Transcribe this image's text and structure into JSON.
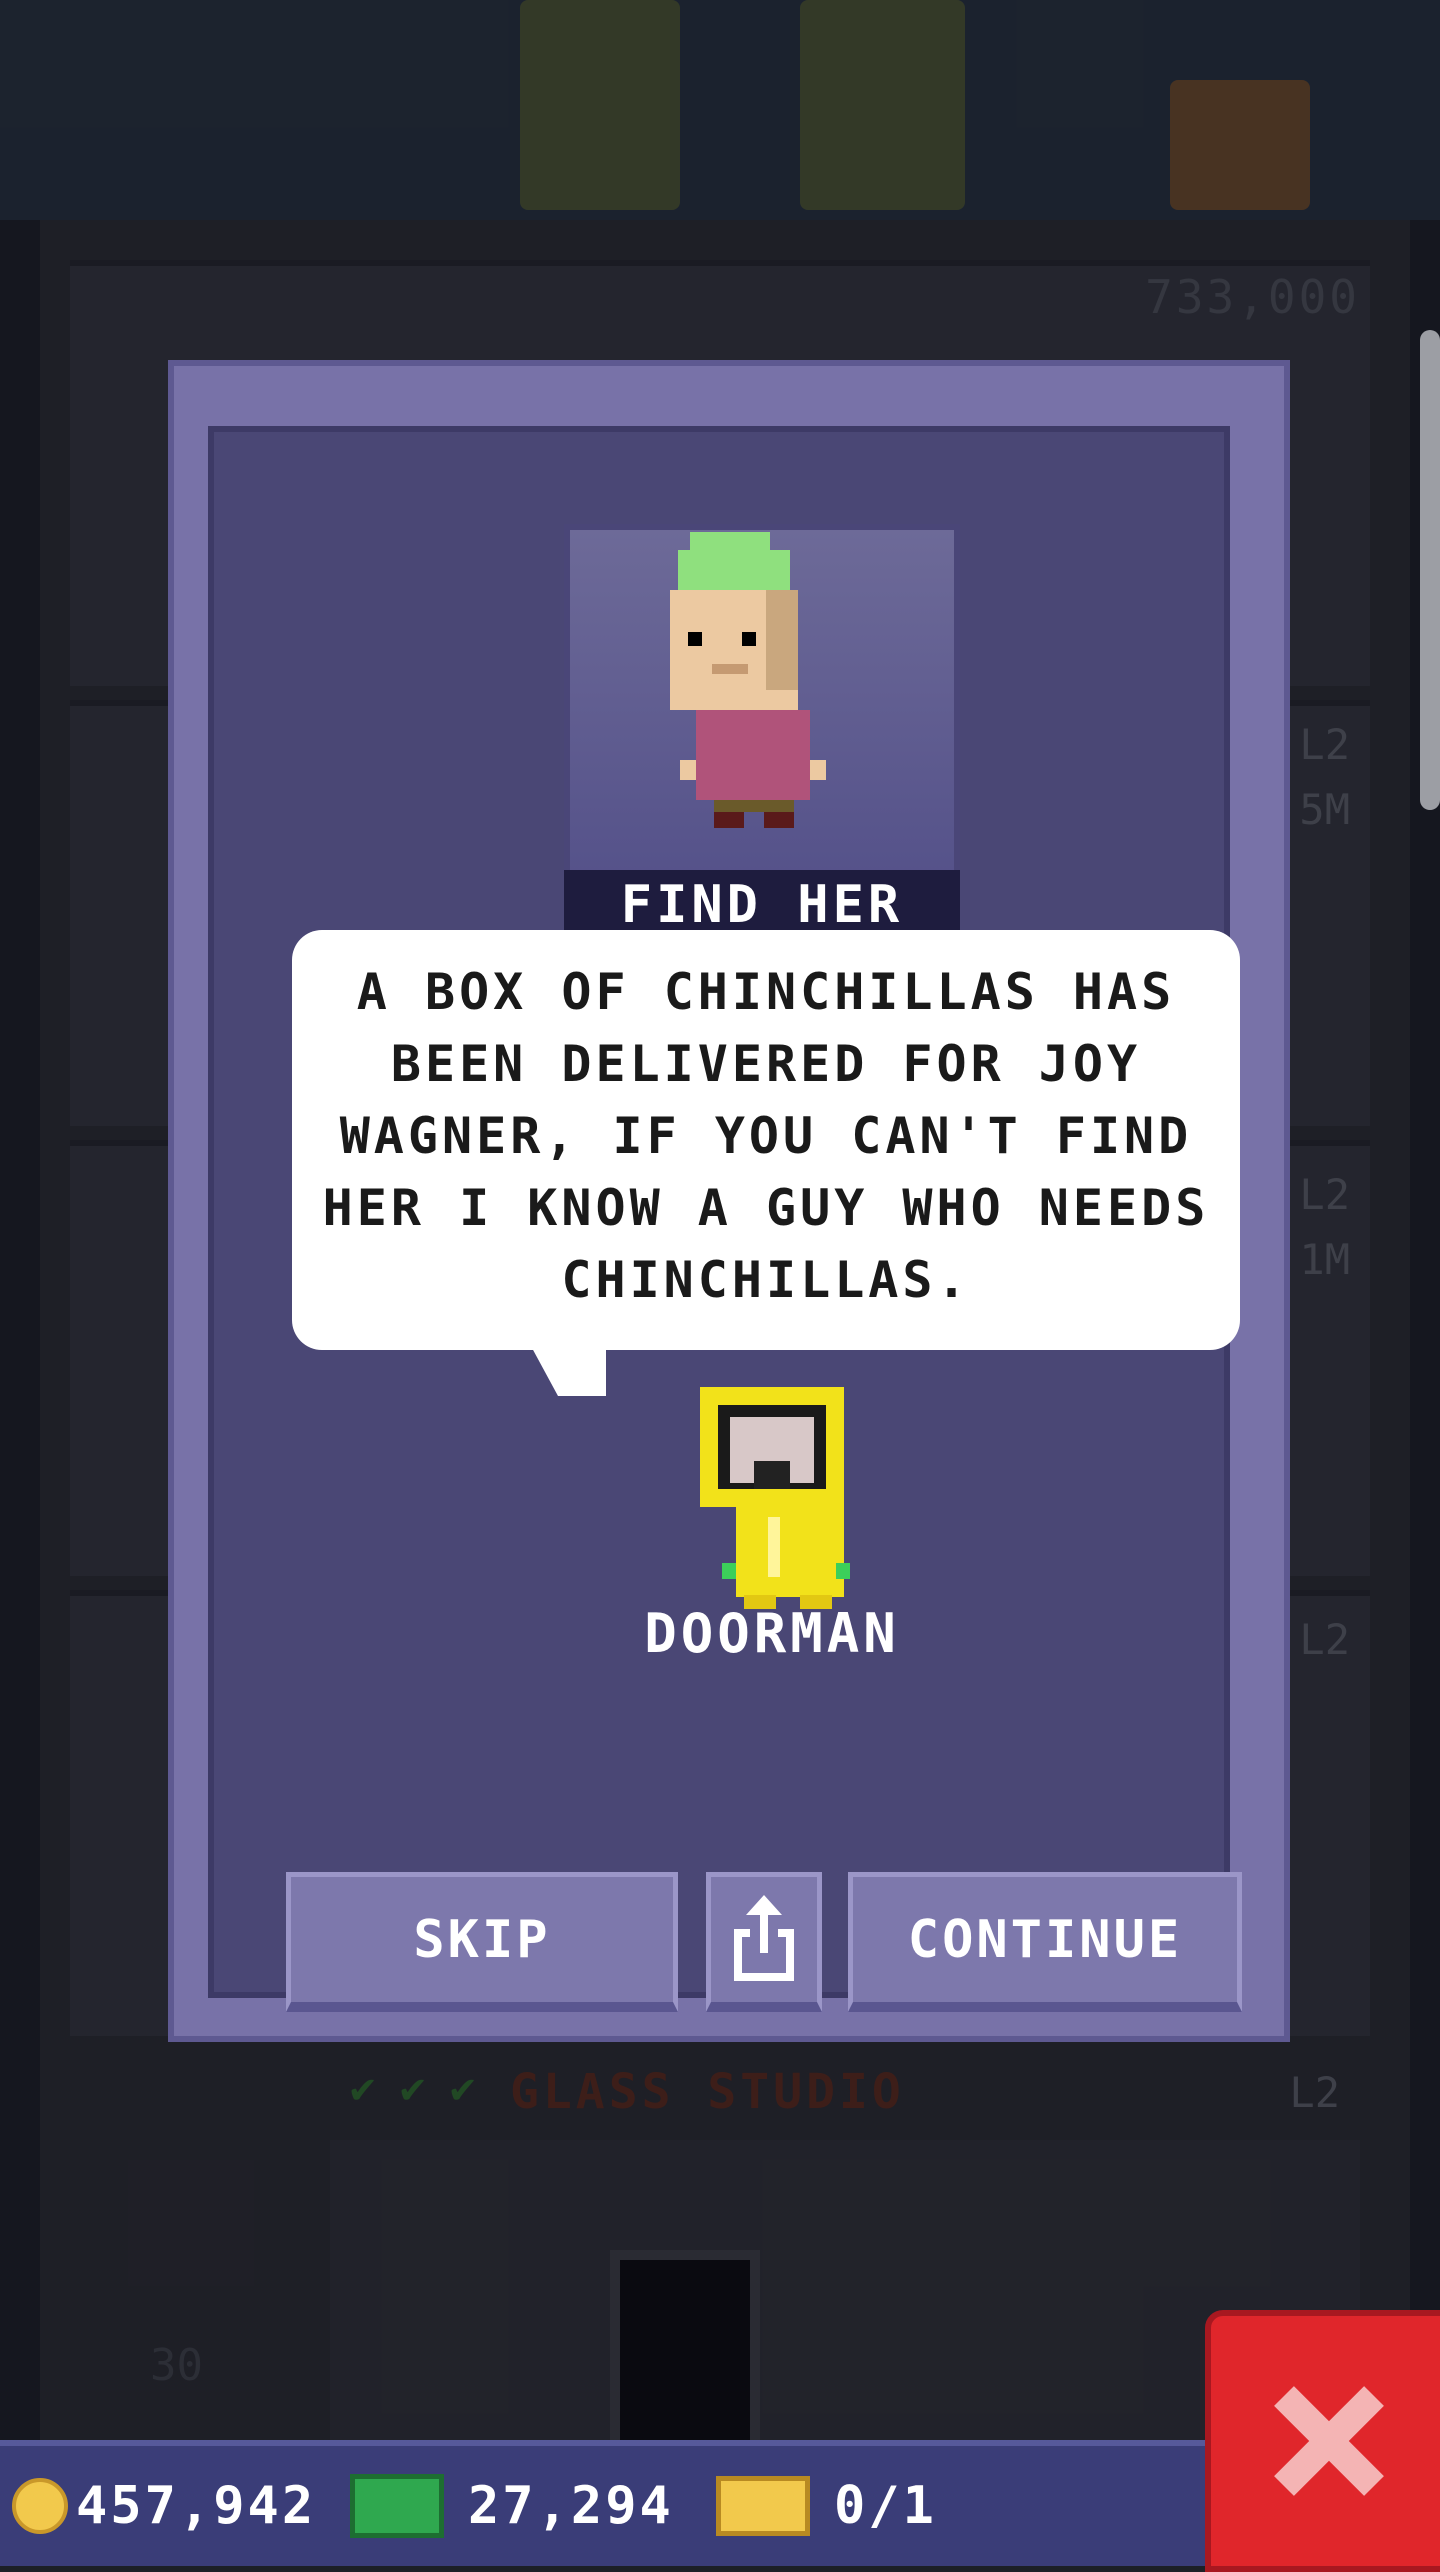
{
  "background": {
    "floor_price": "733,000",
    "level_labels": [
      "L2",
      "5M",
      "L2",
      "1M",
      "L2"
    ],
    "glass_floor": {
      "checks": [
        "✔",
        "✔",
        "✔"
      ],
      "name": "GLASS STUDIO",
      "level": "L2"
    },
    "floor_number": "30"
  },
  "mission": {
    "title": "FIND HER",
    "message": "A BOX OF CHINCHILLAS HAS BEEN DELIVERED FOR JOY WAGNER, IF YOU CAN'T FIND HER I KNOW A GUY WHO NEEDS CHINCHILLAS.",
    "speaker": "DOORMAN",
    "buttons": {
      "skip": "SKIP",
      "continue": "CONTINUE",
      "share_icon": "share-icon"
    }
  },
  "hud": {
    "coins": "457,942",
    "bux": "27,294",
    "tickets": "0/1",
    "close_icon": "close-x-icon"
  },
  "colors": {
    "modal_outer": "#7872a8",
    "modal_inner": "#4a4775",
    "button": "#7d78ac",
    "hud": "#3a3d78",
    "close": "#e0262b"
  }
}
